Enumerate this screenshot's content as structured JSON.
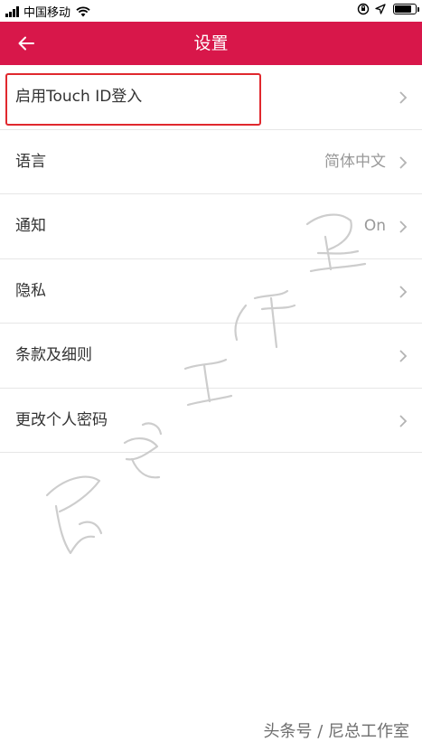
{
  "status_bar": {
    "carrier": "中国移动",
    "battery_level": 0.85
  },
  "header": {
    "title": "设置",
    "back_icon": "arrow-left-icon"
  },
  "settings": [
    {
      "label": "启用Touch ID登入",
      "value": ""
    },
    {
      "label": "语言",
      "value": "简体中文"
    },
    {
      "label": "通知",
      "value": "On"
    },
    {
      "label": "隐私",
      "value": ""
    },
    {
      "label": "条款及细则",
      "value": ""
    },
    {
      "label": "更改个人密码",
      "value": ""
    }
  ],
  "watermark": {
    "footer_text": "头条号 / 尼总工作室"
  },
  "colors": {
    "header_bg": "#d8174a",
    "highlight_border": "#e0282e"
  }
}
